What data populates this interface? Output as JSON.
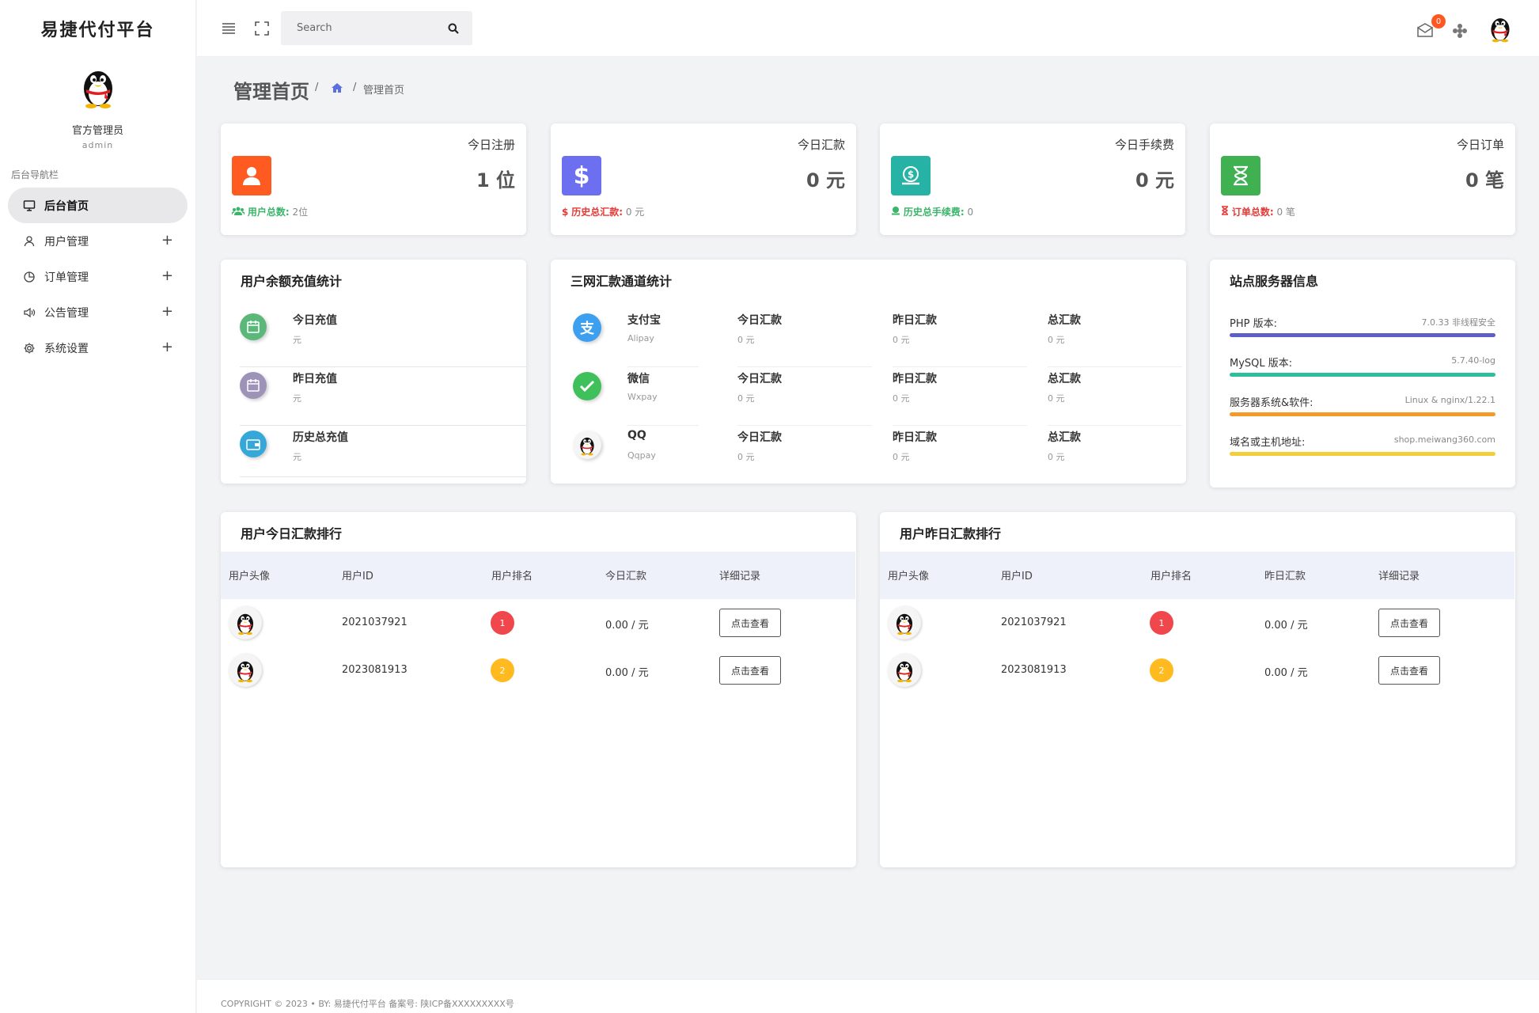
{
  "sidebar": {
    "brand": "易捷代付平台",
    "profile_name": "官方管理员",
    "profile_role": "admin",
    "nav_caption": "后台导航栏",
    "items": [
      {
        "label": "后台首页",
        "icon": "monitor-icon",
        "active": true
      },
      {
        "label": "用户管理",
        "icon": "user-icon",
        "expandable": true
      },
      {
        "label": "订单管理",
        "icon": "pie-chart-icon",
        "expandable": true
      },
      {
        "label": "公告管理",
        "icon": "speaker-icon",
        "expandable": true
      },
      {
        "label": "系统设置",
        "icon": "gear-icon",
        "expandable": true
      }
    ]
  },
  "topbar": {
    "search_placeholder": "Search",
    "notification_count": "0"
  },
  "breadcrumb": {
    "title": "管理首页",
    "sep1": "/",
    "sep2": "/",
    "current": "管理首页"
  },
  "stats": [
    {
      "title": "今日注册",
      "value": "1 位",
      "foot_label": "用户总数:",
      "foot_value": "2位",
      "color": "#ff5a1f",
      "foot_color": "#3ab56a"
    },
    {
      "title": "今日汇款",
      "value": "0 元",
      "foot_label": "历史总汇款:",
      "foot_value": "0 元",
      "color": "#6c70f0",
      "foot_color": "#e53935"
    },
    {
      "title": "今日手续费",
      "value": "0 元",
      "foot_label": "历史总手续费:",
      "foot_value": "0",
      "color": "#26b3a5",
      "foot_color": "#3ab56a"
    },
    {
      "title": "今日订单",
      "value": "0 笔",
      "foot_label": "订单总数:",
      "foot_value": "0 笔",
      "color": "#3fb150",
      "foot_color": "#e53935"
    }
  ],
  "recharge": {
    "title": "用户余额充值统计",
    "rows": [
      {
        "label": "今日充值",
        "value": "元",
        "color": "#5cb87a"
      },
      {
        "label": "昨日充值",
        "value": "元",
        "color": "#9d93b8"
      },
      {
        "label": "历史总充值",
        "value": "元",
        "color": "#35a7d8"
      }
    ]
  },
  "channels": {
    "title": "三网汇款通道统计",
    "rows": [
      {
        "name": "支付宝",
        "code": "Alipay",
        "today_label": "今日汇款",
        "today": "0 元",
        "yesterday_label": "昨日汇款",
        "yesterday": "0 元",
        "total_label": "总汇款",
        "total": "0 元"
      },
      {
        "name": "微信",
        "code": "Wxpay",
        "today_label": "今日汇款",
        "today": "0 元",
        "yesterday_label": "昨日汇款",
        "yesterday": "0 元",
        "total_label": "总汇款",
        "total": "0 元"
      },
      {
        "name": "QQ",
        "code": "Qqpay",
        "today_label": "今日汇款",
        "today": "0 元",
        "yesterday_label": "昨日汇款",
        "yesterday": "0 元",
        "total_label": "总汇款",
        "total": "0 元"
      }
    ]
  },
  "server": {
    "title": "站点服务器信息",
    "rows": [
      {
        "label": "PHP 版本:",
        "value": "7.0.33 非线程安全",
        "color": "#5b5fc7"
      },
      {
        "label": "MySQL 版本:",
        "value": "5.7.40-log",
        "color": "#2dbf9a"
      },
      {
        "label": "服务器系统&软件:",
        "value": "Linux & nginx/1.22.1",
        "color": "#f39a2b"
      },
      {
        "label": "域名或主机地址:",
        "value": "shop.meiwang360.com",
        "color": "#f4cd3a"
      }
    ]
  },
  "rank_today": {
    "title": "用户今日汇款排行",
    "headers": [
      "用户头像",
      "用户ID",
      "用户排名",
      "今日汇款",
      "详细记录"
    ],
    "rows": [
      {
        "user_id": "2021037921",
        "rank": "1",
        "rank_color": "#f0474d",
        "amount": "0.00 / 元",
        "action": "点击查看"
      },
      {
        "user_id": "2023081913",
        "rank": "2",
        "rank_color": "#ffba1f",
        "amount": "0.00 / 元",
        "action": "点击查看"
      }
    ]
  },
  "rank_yesterday": {
    "title": "用户昨日汇款排行",
    "headers": [
      "用户头像",
      "用户ID",
      "用户排名",
      "昨日汇款",
      "详细记录"
    ],
    "rows": [
      {
        "user_id": "2021037921",
        "rank": "1",
        "rank_color": "#f0474d",
        "amount": "0.00 / 元",
        "action": "点击查看"
      },
      {
        "user_id": "2023081913",
        "rank": "2",
        "rank_color": "#ffba1f",
        "amount": "0.00 / 元",
        "action": "点击查看"
      }
    ]
  },
  "footer": {
    "text": "COPYRIGHT © 2023 • BY: 易捷代付平台  备案号: 陕ICP备XXXXXXXXX号"
  }
}
